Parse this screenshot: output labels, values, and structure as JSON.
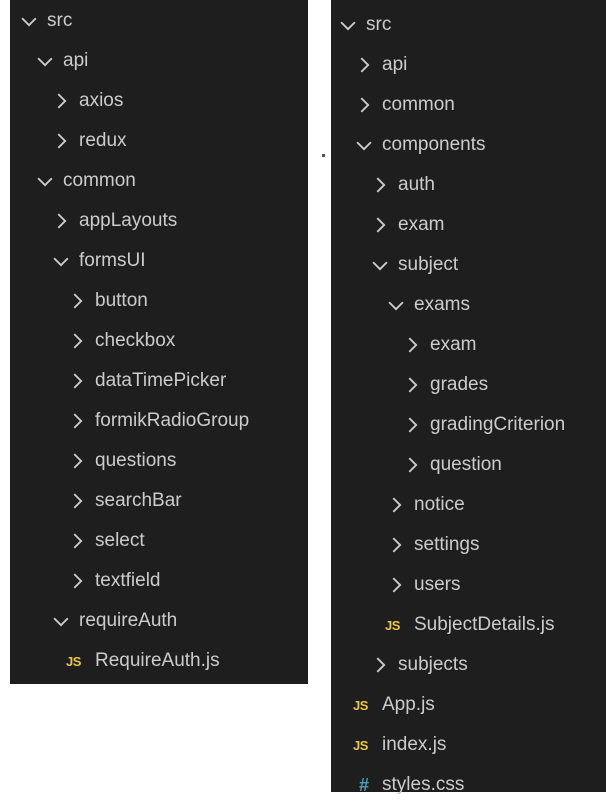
{
  "left_tree": [
    {
      "label": "src",
      "type": "folder",
      "open": true,
      "depth": 0
    },
    {
      "label": "api",
      "type": "folder",
      "open": true,
      "depth": 1
    },
    {
      "label": "axios",
      "type": "folder",
      "open": false,
      "depth": 2
    },
    {
      "label": "redux",
      "type": "folder",
      "open": false,
      "depth": 2
    },
    {
      "label": "common",
      "type": "folder",
      "open": true,
      "depth": 1
    },
    {
      "label": "appLayouts",
      "type": "folder",
      "open": false,
      "depth": 2
    },
    {
      "label": "formsUI",
      "type": "folder",
      "open": true,
      "depth": 2
    },
    {
      "label": "button",
      "type": "folder",
      "open": false,
      "depth": 3
    },
    {
      "label": "checkbox",
      "type": "folder",
      "open": false,
      "depth": 3
    },
    {
      "label": "dataTimePicker",
      "type": "folder",
      "open": false,
      "depth": 3
    },
    {
      "label": "formikRadioGroup",
      "type": "folder",
      "open": false,
      "depth": 3
    },
    {
      "label": "questions",
      "type": "folder",
      "open": false,
      "depth": 3
    },
    {
      "label": "searchBar",
      "type": "folder",
      "open": false,
      "depth": 3
    },
    {
      "label": "select",
      "type": "folder",
      "open": false,
      "depth": 3
    },
    {
      "label": "textfield",
      "type": "folder",
      "open": false,
      "depth": 3
    },
    {
      "label": "requireAuth",
      "type": "folder",
      "open": true,
      "depth": 2
    },
    {
      "label": "RequireAuth.js",
      "type": "js",
      "depth": 3
    }
  ],
  "right_tree": [
    {
      "label": "src",
      "type": "folder",
      "open": true,
      "depth": 0
    },
    {
      "label": "api",
      "type": "folder",
      "open": false,
      "depth": 1
    },
    {
      "label": "common",
      "type": "folder",
      "open": false,
      "depth": 1
    },
    {
      "label": "components",
      "type": "folder",
      "open": true,
      "depth": 1
    },
    {
      "label": "auth",
      "type": "folder",
      "open": false,
      "depth": 2
    },
    {
      "label": "exam",
      "type": "folder",
      "open": false,
      "depth": 2
    },
    {
      "label": "subject",
      "type": "folder",
      "open": true,
      "depth": 2
    },
    {
      "label": "exams",
      "type": "folder",
      "open": true,
      "depth": 3
    },
    {
      "label": "exam",
      "type": "folder",
      "open": false,
      "depth": 4
    },
    {
      "label": "grades",
      "type": "folder",
      "open": false,
      "depth": 4
    },
    {
      "label": "gradingCriterion",
      "type": "folder",
      "open": false,
      "depth": 4
    },
    {
      "label": "question",
      "type": "folder",
      "open": false,
      "depth": 4
    },
    {
      "label": "notice",
      "type": "folder",
      "open": false,
      "depth": 3
    },
    {
      "label": "settings",
      "type": "folder",
      "open": false,
      "depth": 3
    },
    {
      "label": "users",
      "type": "folder",
      "open": false,
      "depth": 3
    },
    {
      "label": "SubjectDetails.js",
      "type": "js",
      "depth": 3
    },
    {
      "label": "subjects",
      "type": "folder",
      "open": false,
      "depth": 2
    },
    {
      "label": "App.js",
      "type": "js",
      "depth": 1
    },
    {
      "label": "index.js",
      "type": "js",
      "depth": 1
    },
    {
      "label": "styles.css",
      "type": "css",
      "depth": 1
    }
  ],
  "icons": {
    "js_badge": "JS",
    "css_badge": "#",
    "expanded": "chevron-down-icon",
    "collapsed": "chevron-right-icon"
  },
  "colors": {
    "background": "#1e1e1e",
    "text": "#cccccc",
    "js_badge": "#e8c54a",
    "css_badge": "#519aba"
  }
}
